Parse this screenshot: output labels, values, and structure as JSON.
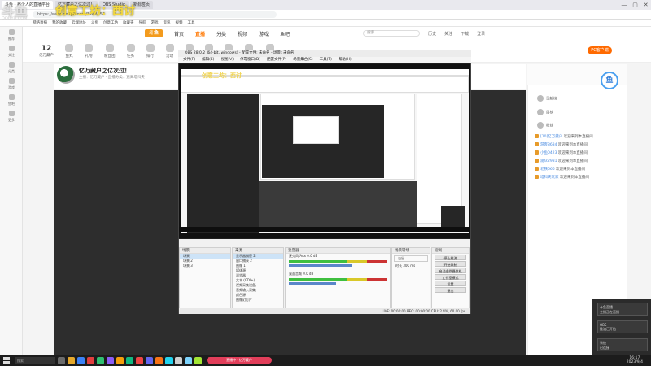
{
  "watermark": {
    "logo": "斗鱼",
    "sub": "DOUYU.COM",
    "text": "创意工坊：西讨"
  },
  "browser": {
    "tabs": [
      "斗鱼 - 每个人的直播平台",
      "忆万藏户之亿次过！",
      "OBS Studio",
      "新标签页"
    ],
    "url": "https://www.douyu.com/1748452",
    "bookmarks": [
      "网络直播",
      "我的收藏",
      "云端地址",
      "斗鱼",
      "创意工坊",
      "收藏夹",
      "导航",
      "游戏",
      "资讯",
      "视频",
      "工具"
    ],
    "window_controls": [
      "—",
      "▢",
      "✕"
    ]
  },
  "rail": [
    {
      "label": "推荐"
    },
    {
      "label": "关注"
    },
    {
      "label": "分类"
    },
    {
      "label": "游戏"
    },
    {
      "label": "鱼吧"
    },
    {
      "label": "更多"
    }
  ],
  "site_nav": {
    "logo": "斗鱼",
    "links": [
      "首页",
      "直播",
      "分类",
      "视频",
      "游戏",
      "鱼吧"
    ],
    "active_index": 1,
    "search_placeholder": "搜索",
    "right_buttons": [
      "历史",
      "关注",
      "下载",
      "登录"
    ]
  },
  "top_row": {
    "level_value": "12",
    "level_label": "亿万藏户",
    "icons": [
      "鱼丸",
      "礼物",
      "粉丝团",
      "任务",
      "排行",
      "活动",
      "分享",
      "录制",
      "截图",
      "直播间",
      "设置"
    ],
    "pc_button": "PC客户端"
  },
  "stream": {
    "title": "忆万藏户之亿次过！",
    "meta": "主播：忆万藏户  ·  直播分类：逃离塔科夫"
  },
  "obs": {
    "title": "OBS 28.0.2 (64-bit, windows) - 配置文件: 未命名 - 场景: 未命名",
    "menu": [
      "文件(F)",
      "编辑(E)",
      "视图(V)",
      "停靠窗口(D)",
      "配置文件(P)",
      "场景集合(S)",
      "工具(T)",
      "帮助(H)"
    ],
    "scenes": {
      "title": "场景",
      "items": [
        "场景",
        "场景 2",
        "场景 3"
      ],
      "selected": 0
    },
    "sources": {
      "title": "来源",
      "items": [
        "显示器捕获 2",
        "窗口捕获 2",
        "图像 1",
        "媒体源",
        "浏览器",
        "文本 (GDI+)",
        "视频采集设备",
        "音频输入采集",
        "颜色源",
        "图像幻灯片"
      ],
      "selected": 0
    },
    "mixer": {
      "title": "混音器",
      "channels": [
        {
          "name": "麦克风/Aux",
          "db": "0.0 dB"
        },
        {
          "name": "桌面音频",
          "db": "0.0 dB"
        }
      ]
    },
    "transitions": {
      "title": "场景转场",
      "type": "淡出",
      "duration_label": "时长",
      "duration": "300 ms"
    },
    "controls": {
      "title": "控制",
      "buttons": [
        "停止推流",
        "开始录制",
        "启动虚拟摄像机",
        "工作室模式",
        "设置",
        "退出"
      ]
    },
    "status": "LIVE: 00:00:00    REC: 00:00:00    CPU: 2.4%, 60.00 fps"
  },
  "chat": {
    "mascot": "鱼",
    "ranks": [
      "贡献榜",
      "周榜",
      "粉丝"
    ],
    "lines": [
      {
        "name": "[10]忆万藏户",
        "text": "欢迎来到本直播间"
      },
      {
        "name": "游客8634",
        "text": "欢迎来到本直播间"
      },
      {
        "name": "小鱼0423",
        "text": "欢迎来到本直播间"
      },
      {
        "name": "观众2981",
        "text": "欢迎来到本直播间"
      },
      {
        "name": "老铁666",
        "text": "欢迎来到本直播间"
      },
      {
        "name": "塔科夫玩家",
        "text": "欢迎来到本直播间"
      }
    ]
  },
  "notifications": [
    {
      "title": "斗鱼直播",
      "text": "主播正在直播"
    },
    {
      "title": "OBS",
      "text": "推流已开始"
    },
    {
      "title": "系统",
      "text": "已连接"
    }
  ],
  "taskbar": {
    "search": "搜索",
    "pill": "直播中 · 忆万藏户",
    "time": "16:17",
    "date": "2023/9/4",
    "app_colors": [
      "#6b6b6b",
      "#e5a82b",
      "#3b82f6",
      "#e23e3e",
      "#2fbf71",
      "#8b5cf6",
      "#f59e0b",
      "#10b981",
      "#ef4444",
      "#6366f1",
      "#f97316",
      "#22d3ee",
      "#cfcfcf",
      "#7dd3fc",
      "#a3e635"
    ]
  }
}
